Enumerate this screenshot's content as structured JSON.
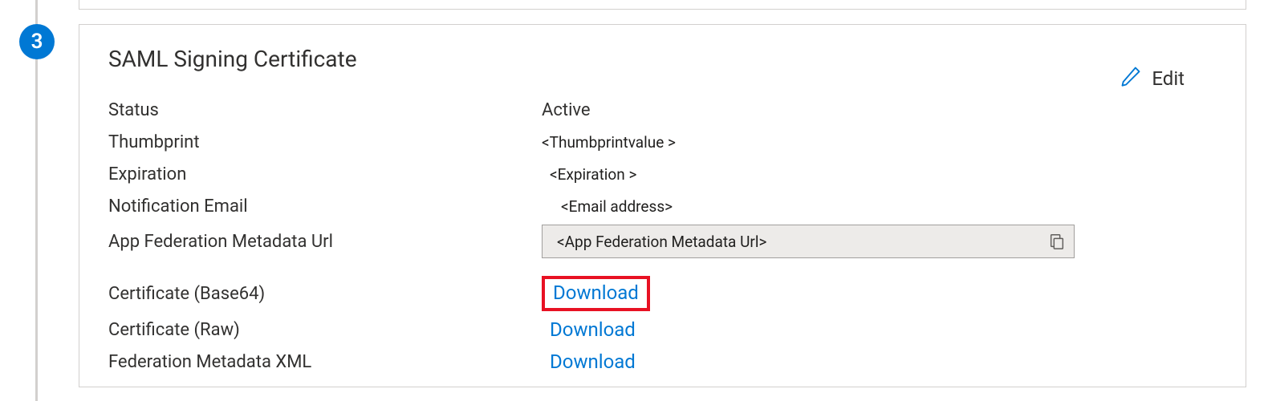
{
  "step": {
    "number": "3"
  },
  "card": {
    "title": "SAML Signing Certificate",
    "edit_label": "Edit"
  },
  "fields": {
    "status": {
      "label": "Status",
      "value": "Active"
    },
    "thumbprint": {
      "label": "Thumbprint",
      "value": "<Thumbprintvalue >"
    },
    "expiration": {
      "label": "Expiration",
      "value": "<Expiration >"
    },
    "email": {
      "label": "Notification Email",
      "value": "<Email address>"
    },
    "metadata_url": {
      "label": "App Federation Metadata Url",
      "value": "<App Federation Metadata Url>"
    },
    "cert_base64": {
      "label": "Certificate (Base64)",
      "action": "Download"
    },
    "cert_raw": {
      "label": "Certificate (Raw)",
      "action": "Download"
    },
    "fed_xml": {
      "label": "Federation Metadata XML",
      "action": "Download"
    }
  }
}
